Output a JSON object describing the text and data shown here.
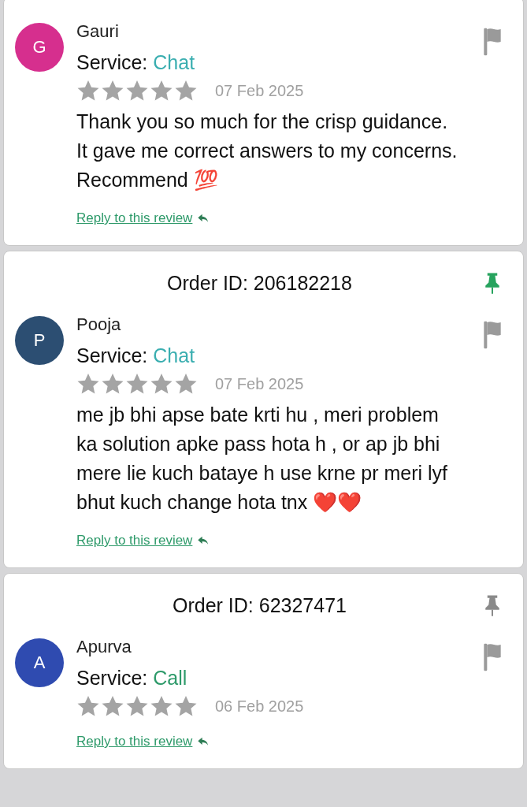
{
  "reviews": [
    {
      "avatar": {
        "letter": "G",
        "color": "#d62f8e"
      },
      "name": "Gauri",
      "service_label": "Service:",
      "service": {
        "label": "Chat",
        "color": "#3aaeb0"
      },
      "stars": 5,
      "date": "07 Feb 2025",
      "text": "Thank you so much for the crisp guidance. It gave me correct answers to my concerns. Recommend 💯",
      "reply": "Reply to this review"
    },
    {
      "order_id": "Order ID: 206182218",
      "pinned": true,
      "avatar": {
        "letter": "P",
        "color": "#2c4e72"
      },
      "name": "Pooja",
      "service_label": "Service:",
      "service": {
        "label": "Chat",
        "color": "#3aaeb0"
      },
      "stars": 5,
      "date": "07 Feb 2025",
      "text": "me jb bhi apse bate krti hu , meri problem ka solution apke pass hota h , or ap jb bhi mere lie kuch bataye h use krne pr meri lyf bhut kuch change hota tnx ❤️❤️",
      "reply": "Reply to this review"
    },
    {
      "order_id": "Order ID: 62327471",
      "pinned": false,
      "avatar": {
        "letter": "A",
        "color": "#2f4bb0"
      },
      "name": "Apurva",
      "service_label": "Service:",
      "service": {
        "label": "Call",
        "color": "#2e9a6a"
      },
      "stars": 5,
      "date": "06 Feb 2025",
      "reply": "Reply to this review"
    }
  ]
}
